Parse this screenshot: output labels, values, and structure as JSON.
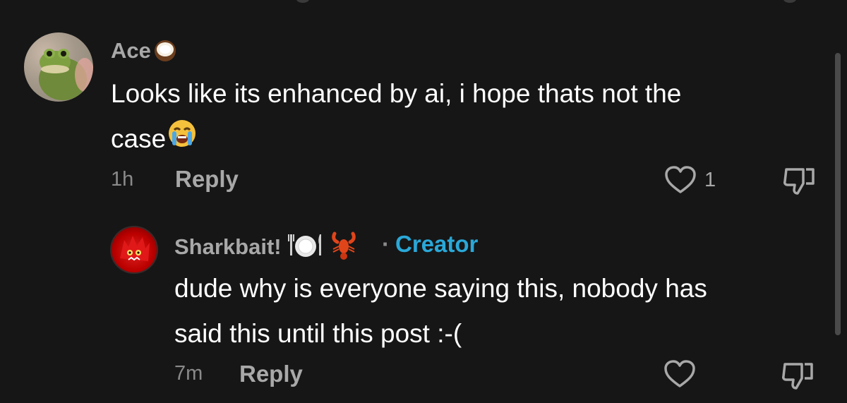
{
  "comments": [
    {
      "username": "Ace",
      "text_line1": "Looks like its enhanced by ai, i hope thats not the",
      "text_line2": "case",
      "time": "1h",
      "reply_label": "Reply",
      "like_count": "1",
      "icons": [
        "coconut-emoji",
        "loudly-crying-face-emoji",
        "heart-icon",
        "thumbs-down-icon"
      ]
    },
    {
      "username": "Sharkbait!",
      "creator_label": "Creator",
      "separator": "·",
      "text_line1": "dude why is everyone saying this, nobody has",
      "text_line2": "said this until this post :-(",
      "time": "7m",
      "reply_label": "Reply",
      "icons": [
        "plate-cutlery-emoji",
        "lobster-emoji",
        "heart-icon",
        "thumbs-down-icon"
      ]
    }
  ],
  "colors": {
    "background": "#161616",
    "username": "#a8a8a8",
    "body_text": "#ffffff",
    "meta": "#8a8a8a",
    "creator": "#2aa8d8"
  }
}
